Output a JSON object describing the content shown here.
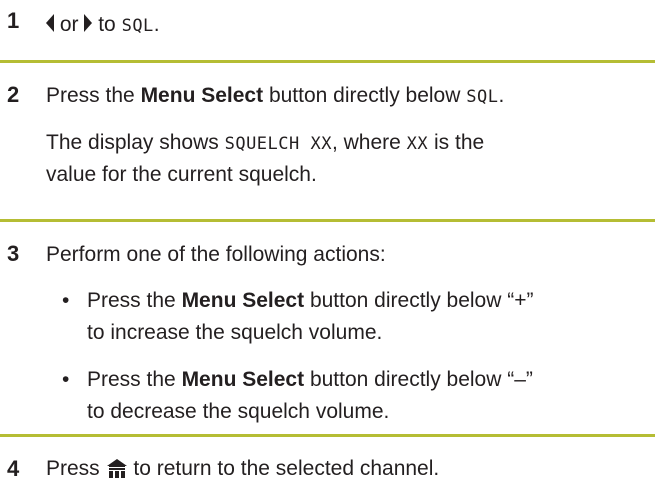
{
  "steps": {
    "s1": {
      "number": "1",
      "or": "or",
      "to": "to",
      "code": "SQL",
      "end": "."
    },
    "s2": {
      "number": "2",
      "press": "Press the",
      "button": "Menu Select",
      "rest": "button directly below",
      "code": "SQL",
      "end": ".",
      "display_pre": "The display shows",
      "display_code": "SQUELCH XX",
      "display_mid": ", where",
      "display_code2": "XX",
      "display_post": "is the",
      "display_line2": "value for the current squelch."
    },
    "s3": {
      "number": "3",
      "intro": "Perform one of the following actions:",
      "bullet": "•",
      "b1_press": "Press the",
      "b1_button": "Menu Select",
      "b1_rest": "button directly below “+”",
      "b1_line2": "to increase the squelch volume.",
      "b2_press": "Press the",
      "b2_button": "Menu Select",
      "b2_rest": "button directly below “–”",
      "b2_line2": "to decrease the squelch volume."
    },
    "s4": {
      "number": "4",
      "press": "Press",
      "rest": "to return to the selected channel."
    }
  },
  "icons": {
    "left": "left-arrow-icon",
    "right": "right-arrow-icon",
    "home": "home-icon"
  },
  "colors": {
    "divider": "#b5bd34",
    "text": "#231f20"
  }
}
